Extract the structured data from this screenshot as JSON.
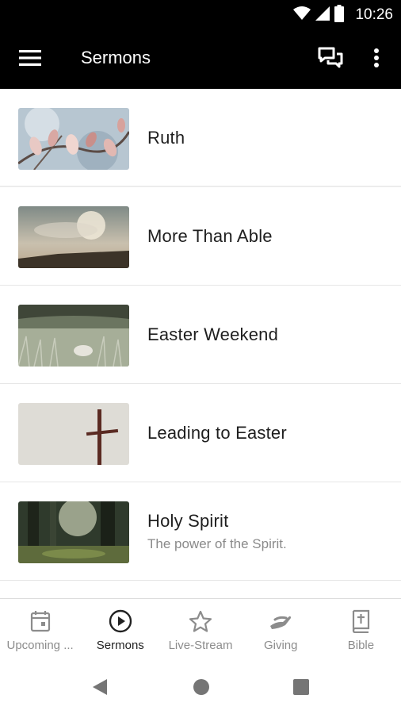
{
  "status_bar": {
    "time": "10:26"
  },
  "app_bar": {
    "title": "Sermons"
  },
  "sermons": [
    {
      "title": "Ruth",
      "subtitle": ""
    },
    {
      "title": "More Than Able",
      "subtitle": ""
    },
    {
      "title": "Easter Weekend",
      "subtitle": ""
    },
    {
      "title": "Leading to Easter",
      "subtitle": ""
    },
    {
      "title": "Holy Spirit",
      "subtitle": "The power of the Spirit."
    }
  ],
  "bottom_nav": [
    {
      "label": "Upcoming ...",
      "icon": "calendar-icon"
    },
    {
      "label": "Sermons",
      "icon": "play-circle-icon",
      "active": true
    },
    {
      "label": "Live-Stream",
      "icon": "star-icon"
    },
    {
      "label": "Giving",
      "icon": "giving-hand-icon"
    },
    {
      "label": "Bible",
      "icon": "bible-icon"
    }
  ],
  "colors": {
    "app_bar": "#000000",
    "active_nav": "#222222",
    "inactive_nav": "#8c8c8c"
  }
}
